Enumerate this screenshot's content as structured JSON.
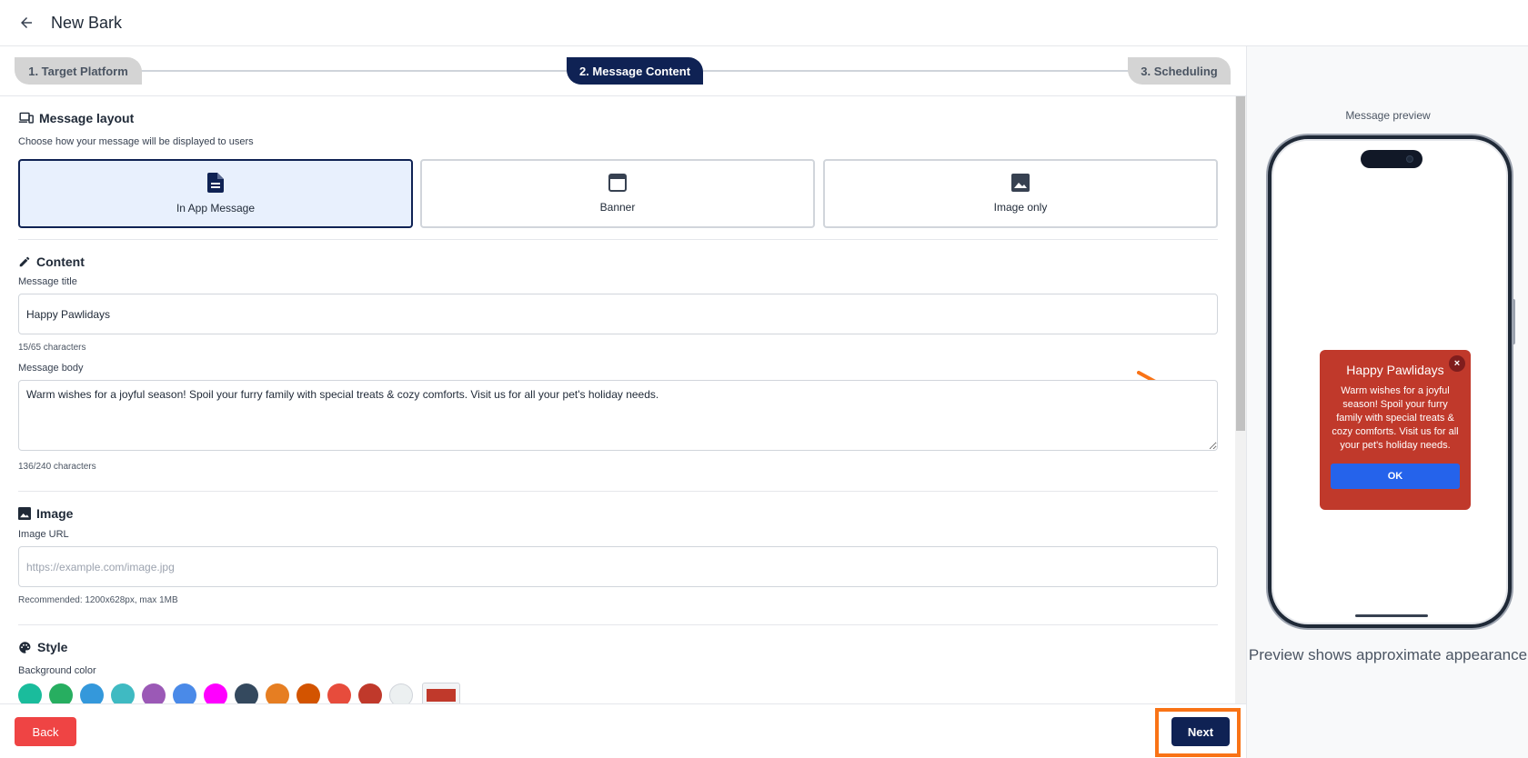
{
  "header": {
    "title": "New Bark"
  },
  "stepper": {
    "steps": [
      {
        "label": "1. Target Platform"
      },
      {
        "label": "2. Message Content"
      },
      {
        "label": "3. Scheduling"
      }
    ]
  },
  "layout": {
    "title": "Message layout",
    "subtitle": "Choose how your message will be displayed to users",
    "options": [
      {
        "label": "In App Message",
        "icon": "document-icon",
        "selected": true
      },
      {
        "label": "Banner",
        "icon": "browser-window-icon",
        "selected": false
      },
      {
        "label": "Image only",
        "icon": "image-icon",
        "selected": false
      }
    ]
  },
  "content": {
    "title": "Content",
    "message_title_label": "Message title",
    "message_title_value": "Happy Pawlidays",
    "message_title_count": "15/65 characters",
    "message_body_label": "Message body",
    "message_body_value": "Warm wishes for a joyful season! Spoil your furry family with special treats & cozy comforts. Visit us for all your pet's holiday needs.",
    "message_body_count": "136/240 characters"
  },
  "image": {
    "title": "Image",
    "url_label": "Image URL",
    "url_placeholder": "https://example.com/image.jpg",
    "hint": "Recommended: 1200x628px, max 1MB"
  },
  "style": {
    "title": "Style",
    "background_label": "Background color",
    "swatches": [
      "#1abc9c",
      "#27ae60",
      "#3498db",
      "#3fbac2",
      "#9b59b6",
      "#4a8ae8",
      "#ff00ff",
      "#34495e",
      "#e67e22",
      "#d35400",
      "#e74c3c",
      "#c0392b",
      "#ecf0f1"
    ],
    "selected_color": "#c0392b"
  },
  "footer": {
    "back_label": "Back",
    "next_label": "Next"
  },
  "preview": {
    "label": "Message preview",
    "message": {
      "title": "Happy Pawlidays",
      "body": "Warm wishes for a joyful season! Spoil your furry family with special treats & cozy comforts. Visit us for all your pet's holiday needs.",
      "close": "×",
      "button": "OK"
    },
    "note": "Preview shows approximate appearance"
  },
  "colors": {
    "primary": "#0f2254",
    "danger": "#ef4444",
    "highlight": "#f97316",
    "ok_button": "#2563eb"
  }
}
